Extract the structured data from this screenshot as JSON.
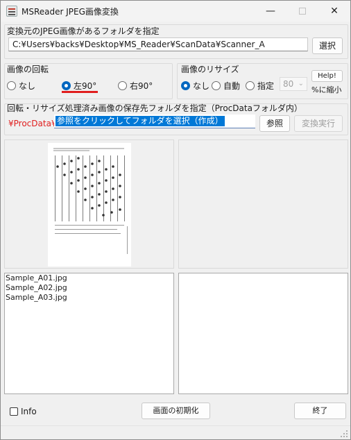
{
  "window": {
    "title": "MSReader JPEG画像変換"
  },
  "source": {
    "label": "変換元のJPEG画像があるフォルダを指定",
    "path": "C:¥Users¥backs¥Desktop¥MS_Reader¥ScanData¥Scanner_A",
    "select_button": "選択"
  },
  "rotation": {
    "label": "画像の回転",
    "options": [
      "なし",
      "左90°",
      "右90°"
    ],
    "selected": "左90°",
    "underline_color": "#e01e1e"
  },
  "resize": {
    "label": "画像のリサイズ",
    "options": [
      "なし",
      "自動",
      "指定"
    ],
    "selected": "なし",
    "size_value": "80",
    "help_button": "Help!",
    "unit_text": "%に縮小"
  },
  "output": {
    "label": "回転・リサイズ処理済み画像の保存先フォルダを指定（ProcDataフォルダ内）",
    "prefix": "¥ProcData¥",
    "prefix_color": "#e01e1e",
    "folder_field_text": "参照をクリックしてフォルダを選択（作成）",
    "browse_button": "参照",
    "convert_button": "変換実行"
  },
  "file_list": {
    "items": [
      "Sample_A01.jpg",
      "Sample_A02.jpg",
      "Sample_A03.jpg"
    ]
  },
  "footer": {
    "info_checkbox": "Info",
    "reset_button": "画面の初期化",
    "exit_button": "終了"
  },
  "colors": {
    "accent": "#0067c0",
    "selection": "#0078d7"
  }
}
